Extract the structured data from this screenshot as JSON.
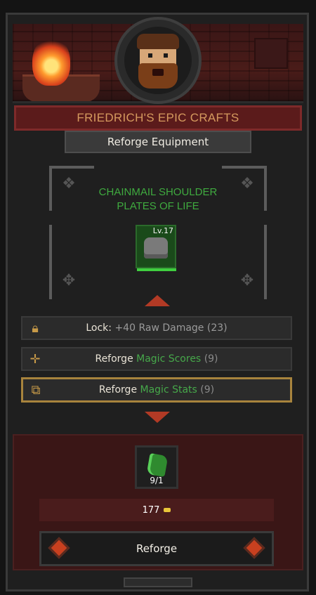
{
  "shop": {
    "title": "FRIEDRICH'S EPIC CRAFTS"
  },
  "tab": {
    "label": "Reforge Equipment"
  },
  "item": {
    "name_line1": "CHAINMAIL SHOULDER",
    "name_line2": "PLATES OF LIFE",
    "level": "Lv.17"
  },
  "options": [
    {
      "prefix": "Lock:",
      "highlight": "+40 Raw Damage",
      "count": "(23)",
      "icon": "lock-icon"
    },
    {
      "prefix": "Reforge",
      "highlight": "Magic Scores",
      "count": "(9)",
      "icon": "sparkle-icon"
    },
    {
      "prefix": "Reforge",
      "highlight": "Magic Stats",
      "count": "(9)",
      "icon": "stats-icon"
    }
  ],
  "material": {
    "count": "9/1"
  },
  "cost": {
    "amount": "177"
  },
  "action": {
    "label": "Reforge"
  },
  "colors": {
    "accent_green": "#46a84a",
    "selected_border": "#a8843d",
    "title_text": "#d59a5e"
  }
}
